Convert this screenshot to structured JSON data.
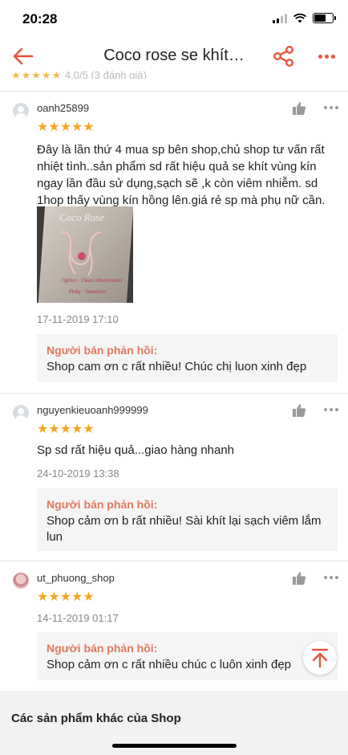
{
  "status": {
    "time": "20:28"
  },
  "header": {
    "title": "Coco rose se khít…"
  },
  "peek": {
    "stars": "★★★★★",
    "text": "4.0/5 (3 đánh giá)"
  },
  "reviews": [
    {
      "username": "oanh25899",
      "stars": "★★★★★",
      "text": "Đây là lần thứ 4 mua sp bên shop,chủ shop tư vấn rất nhiệt tình..sản phẩm sd rất hiệu quả se khít vùng kín ngay lần đầu sử dụng,sạch sẽ ,k còn viêm nhiễm. sd 1hop thấy vùng kín hồng lên.giá rẻ sp mà phụ nữ cần.",
      "photo_text": {
        "brand": "Coco Rose",
        "line1": "Tighten · Clean inflammation",
        "line2": "Pinky · Seduction"
      },
      "date": "17-11-2019 17:10",
      "reply_label": "Người bán phản hồi:",
      "reply": "Shop cam ơn c rất nhiều! Chúc chị luon xinh đẹp"
    },
    {
      "username": "nguyenkieuoanh999999",
      "stars": "★★★★★",
      "text": "Sp sd rất hiệu quả...giao hàng nhanh",
      "date": "24-10-2019 13:38",
      "reply_label": "Người bán phản hồi:",
      "reply": "Shop cảm ơn b rất nhiều! Sài khít lại sạch viêm lắm lun"
    },
    {
      "username": "ut_phuong_shop",
      "stars": "★★★★★",
      "date": "14-11-2019 01:17",
      "reply_label": "Người bán phản hồi:",
      "reply": "Shop cảm ơn c rất nhiều chúc c luôn xinh đẹp"
    }
  ],
  "section": {
    "title": "Các sản phẩm khác của Shop"
  },
  "colors": {
    "accent": "#e8543d",
    "star": "#f6a623",
    "reply_label": "#e0785f"
  },
  "icons": [
    "back-arrow-icon",
    "share-icon",
    "more-icon",
    "thumbs-up-icon",
    "scroll-top-icon",
    "avatar-icon"
  ]
}
